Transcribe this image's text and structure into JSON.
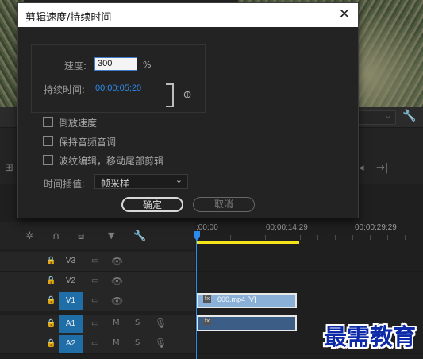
{
  "dialog": {
    "title": "剪辑速度/持续时间",
    "close_glyph": "✕",
    "speed_label": "速度:",
    "speed_value": "300",
    "speed_unit": "%",
    "duration_label": "持续时间:",
    "duration_value": "00;00;05;20",
    "link_glyph": "🔗",
    "checkboxes": [
      {
        "label": "倒放速度",
        "checked": false
      },
      {
        "label": "保持音频音调",
        "checked": false
      },
      {
        "label": "波纹编辑，移动尾部剪辑",
        "checked": false
      }
    ],
    "interp_label": "时间插值:",
    "interp_value": "帧采样",
    "ok_label": "确定",
    "cancel_label": "取消"
  },
  "timeline": {
    "timecodes": [
      ";00;00",
      "00;00;14;29",
      "00;00;29;29"
    ],
    "tracks": [
      {
        "name": "V3",
        "targeted": false
      },
      {
        "name": "V2",
        "targeted": false
      },
      {
        "name": "V1",
        "targeted": true
      },
      {
        "name": "A1",
        "targeted": true
      },
      {
        "name": "A2",
        "targeted": true
      }
    ],
    "audio_mute": "M",
    "audio_solo": "S",
    "video_clip_label": "000.mp4 [V]",
    "fx_label": "fx"
  },
  "watermark": "最需教育",
  "colors": {
    "accent": "#2d8ceb",
    "track_target": "#1f6ea8",
    "video_clip": "#8ab0d8",
    "audio_clip": "#3c5d86",
    "work_area": "#f5e31a",
    "watermark": "#0d2aa8"
  }
}
